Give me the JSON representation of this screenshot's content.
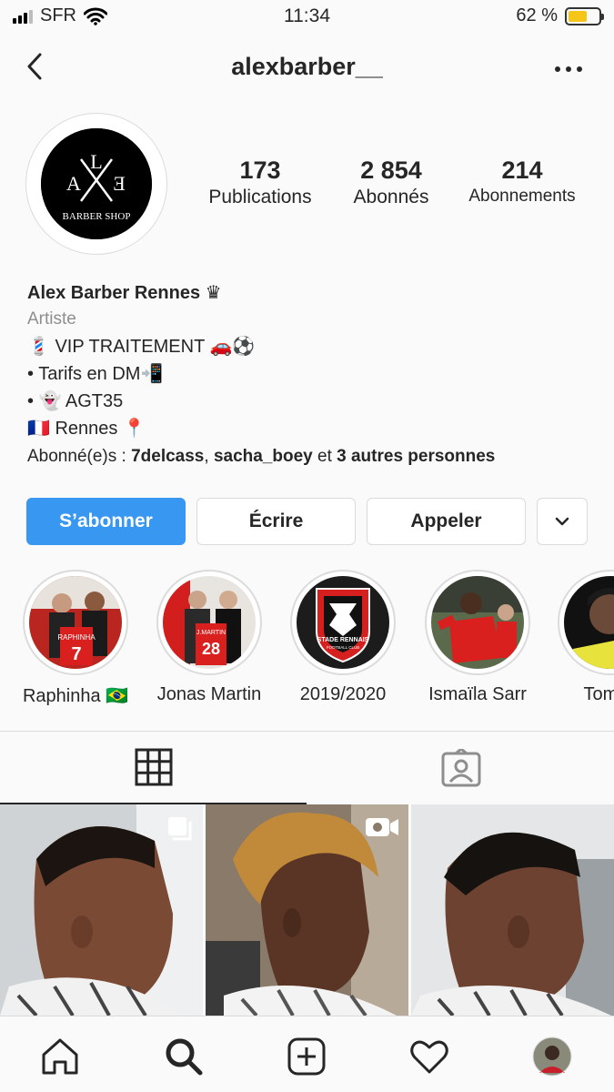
{
  "status_bar": {
    "carrier": "SFR",
    "time": "11:34",
    "battery": "62 %",
    "battery_level": 0.62
  },
  "header": {
    "username": "alexbarber__",
    "back_icon": "chevron-left-icon",
    "more_icon": "ellipsis-icon"
  },
  "profile": {
    "avatar_logo": {
      "letter_a": "A",
      "letter_l": "L",
      "letter_e": "E",
      "caption": "BARBER SHOP"
    },
    "stats": [
      {
        "value": "173",
        "label": "Publications"
      },
      {
        "value": "2 854",
        "label": "Abonnés"
      },
      {
        "value": "214",
        "label": "Abonnements"
      }
    ],
    "name": "Alex Barber Rennes ♛",
    "category": "Artiste",
    "bio_lines": [
      "💈 VIP TRAITEMENT 🚗⚽",
      "• Tarifs en DM📲",
      "• 👻 AGT35",
      "🇫🇷 Rennes 📍"
    ],
    "followed_by": {
      "prefix": "Abonné(e)s : ",
      "user1": "7delcass",
      "sep": ", ",
      "user2": "sacha_boey",
      "and": " et ",
      "others": "3 autres personnes"
    }
  },
  "actions": {
    "follow": "S’abonner",
    "message": "Écrire",
    "call": "Appeler",
    "dropdown_icon": "chevron-down-icon"
  },
  "highlights": [
    {
      "label": "Raphinha 🇧🇷"
    },
    {
      "label": "Jonas Martin"
    },
    {
      "label": "2019/2020"
    },
    {
      "label": "Ismaïla Sarr"
    },
    {
      "label": "Tomás"
    }
  ],
  "jersey_text": {
    "h1_name": "RAPHINHA",
    "h1_number": "7",
    "h2_name": "J.MARTIN",
    "h2_number": "28",
    "h3_club": "STADE RENNAIS",
    "h3_sub": "FOOTBALL CLUB"
  },
  "tabs": [
    {
      "icon": "grid-icon",
      "active": true
    },
    {
      "icon": "tagged-icon",
      "active": false
    }
  ],
  "grid": [
    {
      "badge": "carousel-icon"
    },
    {
      "badge": "video-icon"
    },
    {
      "badge": ""
    }
  ],
  "bottom_nav": [
    "home-icon",
    "search-icon",
    "add-post-icon",
    "heart-icon",
    "profile-icon"
  ],
  "colors": {
    "primary": "#3897f0",
    "text": "#262626",
    "muted": "#8e8e8e",
    "border": "#dbdbdb",
    "rennes_red": "#d6201f"
  }
}
